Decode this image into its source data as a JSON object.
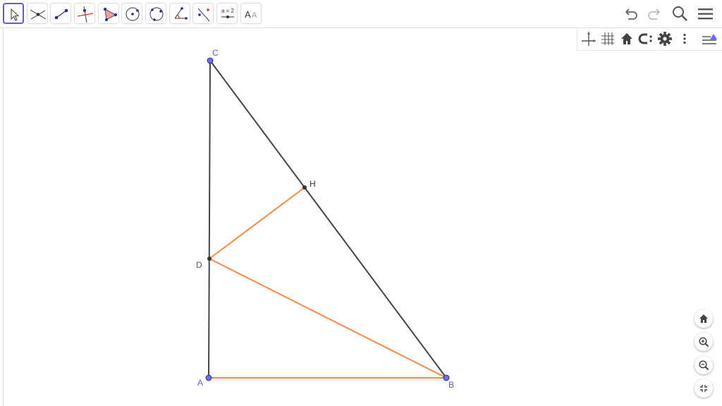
{
  "toolbar": {
    "tools": [
      {
        "icon": "move-arrow-icon",
        "selected": true
      },
      {
        "icon": "point-intersect-icon"
      },
      {
        "icon": "segment-icon"
      },
      {
        "icon": "perpendicular-line-icon"
      },
      {
        "icon": "polygon-icon"
      },
      {
        "icon": "circle-center-point-icon"
      },
      {
        "icon": "circle-three-points-icon"
      },
      {
        "icon": "angle-icon"
      },
      {
        "icon": "reflect-point-icon"
      },
      {
        "icon": "slider-icon",
        "text": "a = 2"
      },
      {
        "icon": "text-icon",
        "text": "AA"
      }
    ],
    "right": [
      "undo-icon",
      "redo-icon",
      "search-icon",
      "menu-icon"
    ]
  },
  "graphics_style_bar": [
    "axes-icon",
    "grid-icon",
    "home-icon",
    "point-capturing-icon",
    "settings-icon",
    "more-icon",
    "style-bar-toggle-icon"
  ],
  "zoom_controls": [
    "home-icon",
    "zoom-in-icon",
    "zoom-out-icon",
    "exit-fullscreen-icon"
  ],
  "construction": {
    "points": [
      {
        "name": "A",
        "label": "A",
        "label_color": "#6557d2",
        "color": "#6d6dff",
        "free": true
      },
      {
        "name": "B",
        "label": "B",
        "label_color": "#6557d2",
        "color": "#6d6dff",
        "free": true
      },
      {
        "name": "C",
        "label": "C",
        "label_color": "#6557d2",
        "color": "#6d6dff",
        "free": true
      },
      {
        "name": "D",
        "label": "D",
        "label_color": "#555555",
        "color": "#333333",
        "free": false
      },
      {
        "name": "H",
        "label": "H",
        "label_color": "#333333",
        "color": "#333333",
        "free": false
      }
    ],
    "segments": [
      {
        "from": "A",
        "to": "C",
        "color": "#444444"
      },
      {
        "from": "C",
        "to": "B",
        "color": "#444444"
      },
      {
        "from": "A",
        "to": "B",
        "color": "#f58a4b"
      },
      {
        "from": "D",
        "to": "B",
        "color": "#f58a4b"
      },
      {
        "from": "D",
        "to": "H",
        "color": "#f58a4b"
      }
    ]
  },
  "colors": {
    "accent": "#6557d2",
    "free_point": "#6d6dff",
    "dependent_point": "#333333",
    "segment_dark": "#444444",
    "segment_orange": "#f58a4b"
  }
}
